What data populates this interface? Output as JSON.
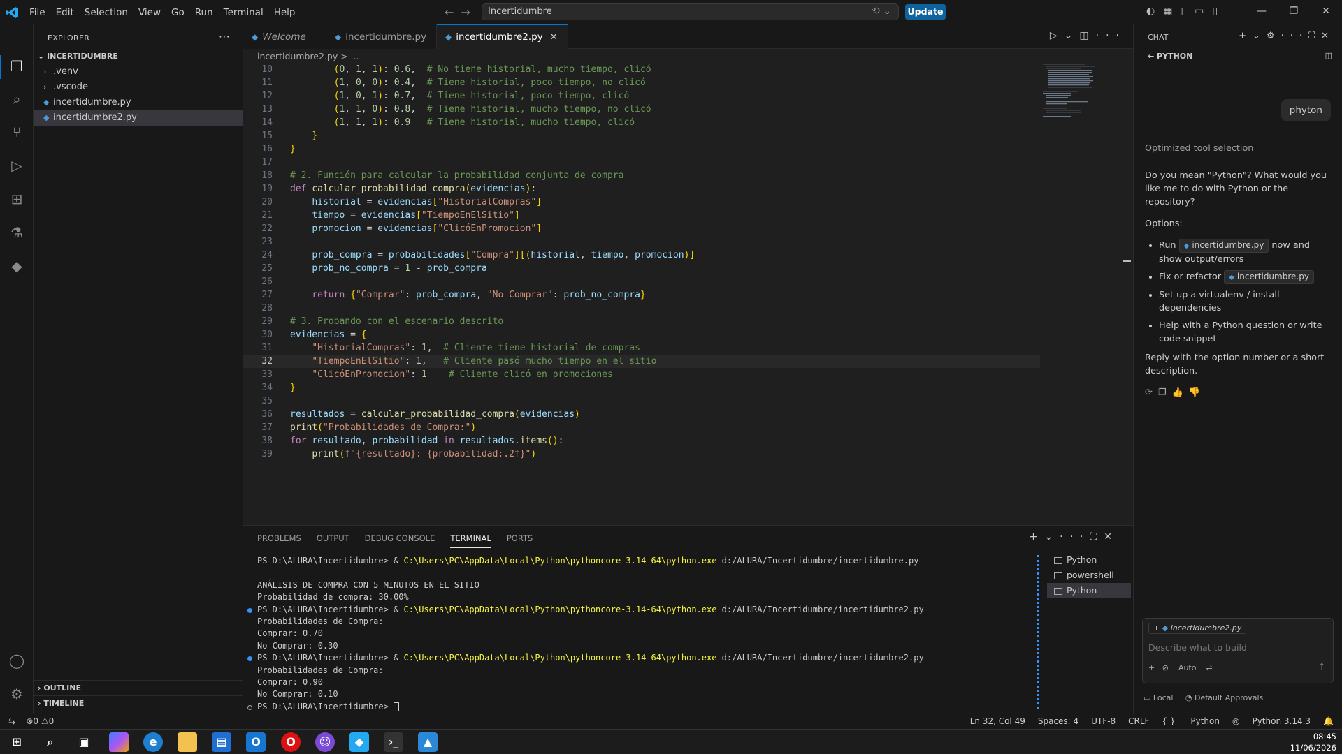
{
  "titlebar": {
    "menu": [
      "File",
      "Edit",
      "Selection",
      "View",
      "Go",
      "Run",
      "Terminal",
      "Help"
    ],
    "command_center": "Incertidumbre",
    "update_label": "Update"
  },
  "explorer": {
    "header": "EXPLORER",
    "root": "INCERTIDUMBRE",
    "items": [
      ".venv",
      ".vscode",
      "incertidumbre.py",
      "incertidumbre2.py"
    ],
    "outline": "OUTLINE",
    "timeline": "TIMELINE"
  },
  "tabs": [
    {
      "label": "Welcome"
    },
    {
      "label": "incertidumbre.py"
    },
    {
      "label": "incertidumbre2.py"
    }
  ],
  "breadcrumb": "incertidumbre2.py > ...",
  "code": {
    "line_numbers": [
      "10",
      "11",
      "12",
      "13",
      "14",
      "15",
      "16",
      "17",
      "18",
      "19",
      "20",
      "21",
      "22",
      "23",
      "24",
      "25",
      "26",
      "27",
      "28",
      "29",
      "30",
      "31",
      "32",
      "33",
      "34",
      "35",
      "36",
      "37",
      "38",
      "39"
    ],
    "lines": [
      "        (0, 1, 1): 0.6,  # No tiene historial, mucho tiempo, clicó",
      "        (1, 0, 0): 0.4,  # Tiene historial, poco tiempo, no clicó",
      "        (1, 0, 1): 0.7,  # Tiene historial, poco tiempo, clicó",
      "        (1, 1, 0): 0.8,  # Tiene historial, mucho tiempo, no clicó",
      "        (1, 1, 1): 0.9   # Tiene historial, mucho tiempo, clicó",
      "    }",
      "}",
      "",
      "# 2. Función para calcular la probabilidad conjunta de compra",
      "def calcular_probabilidad_compra(evidencias):",
      "    historial = evidencias[\"HistorialCompras\"]",
      "    tiempo = evidencias[\"TiempoEnElSitio\"]",
      "    promocion = evidencias[\"ClicóEnPromocion\"]",
      "",
      "    prob_compra = probabilidades[\"Compra\"][(historial, tiempo, promocion)]",
      "    prob_no_compra = 1 - prob_compra",
      "",
      "    return {\"Comprar\": prob_compra, \"No Comprar\": prob_no_compra}",
      "",
      "# 3. Probando con el escenario descrito",
      "evidencias = {",
      "    \"HistorialCompras\": 1,  # Cliente tiene historial de compras",
      "    \"TiempoEnElSitio\": 1,   # Cliente pasó mucho tiempo en el sitio",
      "    \"ClicóEnPromocion\": 1    # Cliente clicó en promociones",
      "}",
      "",
      "resultados = calcular_probabilidad_compra(evidencias)",
      "print(\"Probabilidades de Compra:\")",
      "for resultado, probabilidad in resultados.items():",
      "    print(f\"{resultado}: {probabilidad:.2f}\")"
    ]
  },
  "panel": {
    "tabs": [
      "PROBLEMS",
      "OUTPUT",
      "DEBUG CONSOLE",
      "TERMINAL",
      "PORTS"
    ],
    "terminal_lines": [
      "PS D:\\ALURA\\Incertidumbre> & C:\\Users\\PC\\AppData\\Local\\Python\\pythoncore-3.14-64\\python.exe d:/ALURA/Incertidumbre/incertidumbre.py",
      "",
      "ANÁLISIS DE COMPRA CON 5 MINUTOS EN EL SITIO",
      "Probabilidad de compra: 30.00%",
      "PS D:\\ALURA\\Incertidumbre> & C:\\Users\\PC\\AppData\\Local\\Python\\pythoncore-3.14-64\\python.exe d:/ALURA/Incertidumbre/incertidumbre2.py",
      "Probabilidades de Compra:",
      "Comprar: 0.70",
      "No Comprar: 0.30",
      "PS D:\\ALURA\\Incertidumbre> & C:\\Users\\PC\\AppData\\Local\\Python\\pythoncore-3.14-64\\python.exe d:/ALURA/Incertidumbre/incertidumbre2.py",
      "Probabilidades de Compra:",
      "Comprar: 0.90",
      "No Comprar: 0.10",
      "PS D:\\ALURA\\Incertidumbre> "
    ],
    "terminals": [
      "Python",
      "powershell",
      "Python"
    ]
  },
  "chat": {
    "header": "CHAT",
    "subheader": "PYTHON",
    "user_message": "phyton",
    "status": "Optimized tool selection",
    "question": "Do you mean \"Python\"? What would you like me to do with Python or the repository?",
    "options_label": "Options:",
    "opt1_pre": "Run",
    "opt1_file": "incertidumbre.py",
    "opt1_post": "now and show output/errors",
    "opt2_pre": "Fix or refactor",
    "opt2_file": "incertidumbre.py",
    "opt3": "Set up a virtualenv / install dependencies",
    "opt4": "Help with a Python question or write code snippet",
    "reply_hint": "Reply with the option number or a short description.",
    "attached_file": "incertidumbre2.py",
    "input_placeholder": "Describe what to build",
    "mode": "Auto",
    "footer_local": "Local",
    "footer_approvals": "Default Approvals"
  },
  "statusbar": {
    "problems": "0",
    "warnings": "0",
    "position": "Ln 32, Col 49",
    "spaces": "Spaces: 4",
    "encoding": "UTF-8",
    "eol": "CRLF",
    "language": "Python",
    "interpreter": "Python 3.14.3"
  },
  "taskbar": {
    "time": "08:45",
    "date": "11/06/2026"
  },
  "icons": [
    "vscode-logo-icon",
    "explorer-icon",
    "search-icon",
    "source-control-icon",
    "run-debug-icon",
    "extensions-icon",
    "testing-icon",
    "python-icon",
    "account-icon",
    "settings-icon"
  ]
}
